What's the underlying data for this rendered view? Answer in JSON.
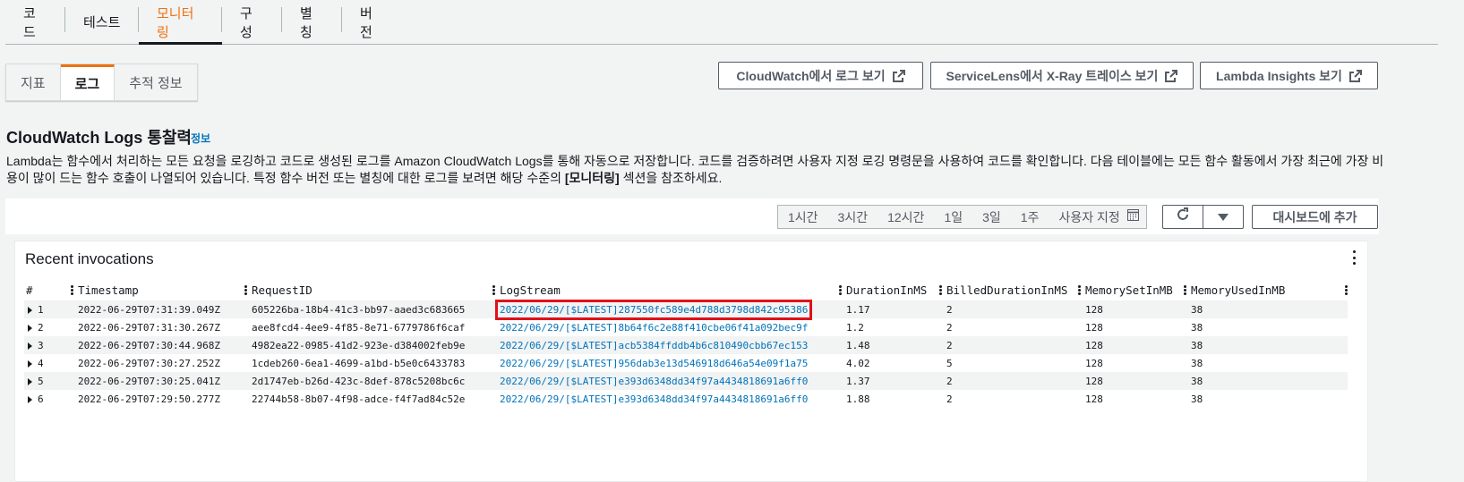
{
  "top_tabs": [
    {
      "label": "코드",
      "active": false
    },
    {
      "label": "테스트",
      "active": false
    },
    {
      "label": "모니터링",
      "active": true
    },
    {
      "label": "구성",
      "active": false
    },
    {
      "label": "별칭",
      "active": false
    },
    {
      "label": "버전",
      "active": false
    }
  ],
  "sub_tabs": [
    {
      "label": "지표",
      "active": false
    },
    {
      "label": "로그",
      "active": true
    },
    {
      "label": "추적 정보",
      "active": false
    }
  ],
  "buttons": {
    "cloudwatch_logs": "CloudWatch에서 로그 보기",
    "servicelens": "ServiceLens에서 X-Ray 트레이스 보기",
    "lambda_insights": "Lambda Insights 보기"
  },
  "section": {
    "title": "CloudWatch Logs 통찰력",
    "info": "정보",
    "description_part1": "Lambda는 함수에서 처리하는 모든 요청을 로깅하고 코드로 생성된 로그를 Amazon CloudWatch Logs를 통해 자동으로 저장합니다. 코드를 검증하려면 사용자 지정 로깅 명령문을 사용하여 코드를 확인합니다. 다음 테이블에는 모든 함수 활동에서 가장 최근에 가장 비용이 많이 드는 함수 호출이 나열되어 있습니다. 특정 함수 버전 또는 별칭에 대한 로그를 보려면 해당 수준의 ",
    "description_bold": "[모니터링]",
    "description_part2": " 섹션을 참조하세요."
  },
  "time_ranges": [
    "1시간",
    "3시간",
    "12시간",
    "1일",
    "3일",
    "1주",
    "사용자 지정"
  ],
  "add_to_dashboard": "대시보드에 추가",
  "widget": {
    "title": "Recent invocations",
    "columns": [
      "#",
      "Timestamp",
      "RequestID",
      "LogStream",
      "DurationInMS",
      "BilledDurationInMS",
      "MemorySetInMB",
      "MemoryUsedInMB"
    ],
    "rows": [
      {
        "n": "1",
        "timestamp": "2022-06-29T07:31:39.049Z",
        "request_id": "605226ba-18b4-41c3-bb97-aaed3c683665",
        "log_stream": "2022/06/29/[$LATEST]287550fc589e4d788d3798d842c95386",
        "duration": "1.17",
        "billed": "2",
        "mem_set": "128",
        "mem_used": "38",
        "highlighted": true
      },
      {
        "n": "2",
        "timestamp": "2022-06-29T07:31:30.267Z",
        "request_id": "aee8fcd4-4ee9-4f85-8e71-6779786f6caf",
        "log_stream": "2022/06/29/[$LATEST]8b64f6c2e88f410cbe06f41a092bec9f",
        "duration": "1.2",
        "billed": "2",
        "mem_set": "128",
        "mem_used": "38"
      },
      {
        "n": "3",
        "timestamp": "2022-06-29T07:30:44.968Z",
        "request_id": "4982ea22-0985-41d2-923e-d384002feb9e",
        "log_stream": "2022/06/29/[$LATEST]acb5384ffddb4b6c810490cbb67ec153",
        "duration": "1.48",
        "billed": "2",
        "mem_set": "128",
        "mem_used": "38"
      },
      {
        "n": "4",
        "timestamp": "2022-06-29T07:30:27.252Z",
        "request_id": "1cdeb260-6ea1-4699-a1bd-b5e0c6433783",
        "log_stream": "2022/06/29/[$LATEST]956dab3e13d546918d646a54e09f1a75",
        "duration": "4.02",
        "billed": "5",
        "mem_set": "128",
        "mem_used": "38"
      },
      {
        "n": "5",
        "timestamp": "2022-06-29T07:30:25.041Z",
        "request_id": "2d1747eb-b26d-423c-8def-878c5208bc6c",
        "log_stream": "2022/06/29/[$LATEST]e393d6348dd34f97a4434818691a6ff0",
        "duration": "1.37",
        "billed": "2",
        "mem_set": "128",
        "mem_used": "38"
      },
      {
        "n": "6",
        "timestamp": "2022-06-29T07:29:50.277Z",
        "request_id": "22744b58-8b07-4f98-adce-f4f7ad84c52e",
        "log_stream": "2022/06/29/[$LATEST]e393d6348dd34f97a4434818691a6ff0",
        "duration": "1.88",
        "billed": "2",
        "mem_set": "128",
        "mem_used": "38"
      }
    ]
  },
  "colors": {
    "accent": "#ec7211",
    "link": "#0073bb",
    "highlight": "#e0111a"
  }
}
